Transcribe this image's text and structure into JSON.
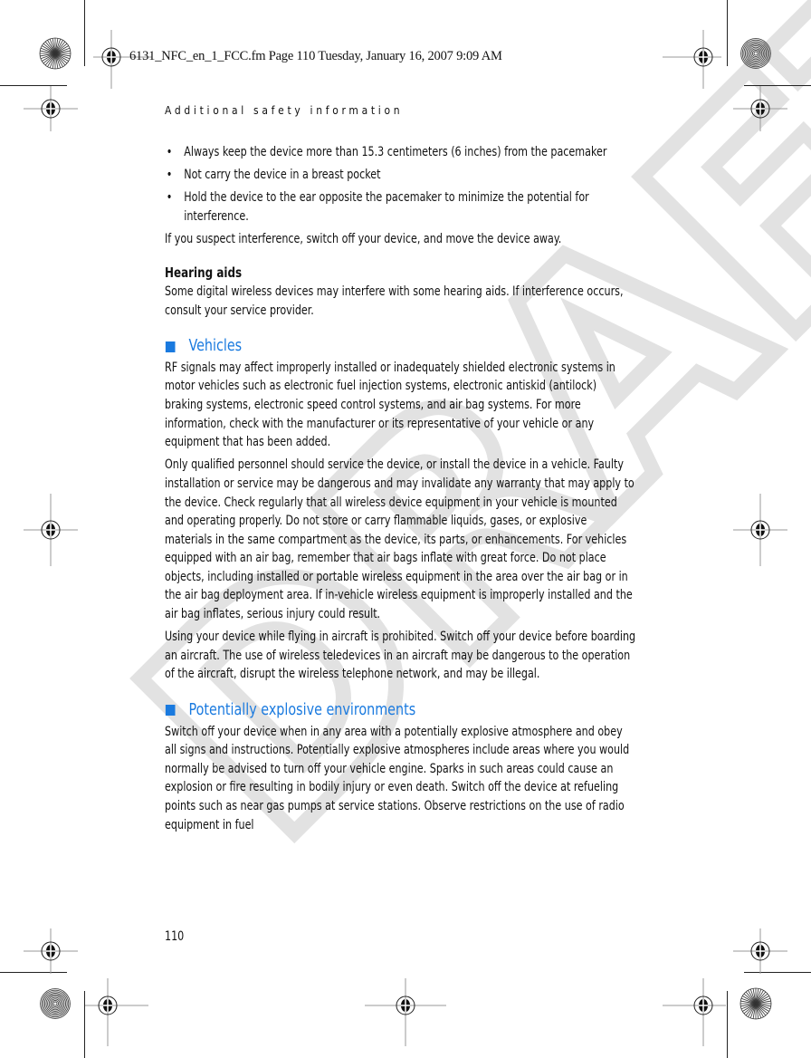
{
  "print_slug": "6131_NFC_en_1_FCC.fm  Page 110  Tuesday, January 16, 2007  9:09 AM",
  "running_head": "Additional safety information",
  "pacemaker_bullets": [
    "Always keep the device more than 15.3 centimeters (6 inches) from the pacemaker",
    "Not carry the device in a breast pocket",
    "Hold the device to the ear opposite the pacemaker to minimize the potential for interference."
  ],
  "pacemaker_note": "If you suspect interference, switch off your device, and move the device away.",
  "hearing_aids": {
    "title": "Hearing aids",
    "body": "Some digital wireless devices may interfere with some hearing aids. If interference occurs, consult your service provider."
  },
  "vehicles": {
    "title": "Vehicles",
    "paragraphs": [
      "RF signals may affect improperly installed or inadequately shielded electronic systems in motor vehicles such as electronic fuel injection systems, electronic antiskid (antilock) braking systems, electronic speed control systems, and air bag systems. For more information, check with the manufacturer or its representative of your vehicle or any equipment that has been added.",
      "Only qualified personnel should service the device, or install the device in a vehicle. Faulty installation or service may be dangerous and may invalidate any warranty that may apply to the device. Check regularly that all wireless device equipment in your vehicle is mounted and operating properly. Do not store or carry flammable liquids, gases, or explosive materials in the same compartment as the device, its parts, or enhancements. For vehicles equipped with an air bag, remember that air bags inflate with great force. Do not place objects, including installed or portable wireless equipment in the area over the air bag or in the air bag deployment area. If in-vehicle wireless equipment is improperly installed and the air bag inflates, serious injury could result.",
      "Using your device while flying in aircraft is prohibited. Switch off your device before boarding an aircraft. The use of wireless teledevices in an aircraft may be dangerous to the operation of the aircraft, disrupt the wireless telephone network, and may be illegal."
    ]
  },
  "explosive": {
    "title": "Potentially explosive environments",
    "body": "Switch off your device when in any area with a potentially explosive atmosphere and obey all signs and instructions. Potentially explosive atmospheres include areas where you would normally be advised to turn off your vehicle engine. Sparks in such areas could cause an explosion or fire resulting in bodily injury or even death. Switch off the device at refueling points such as near gas pumps at service stations. Observe restrictions on the use of radio equipment in fuel"
  },
  "page_number": "110",
  "watermark": "DRAFT",
  "colors": {
    "section_heading": "#1a7adf",
    "watermark": "#e0e0e0"
  }
}
